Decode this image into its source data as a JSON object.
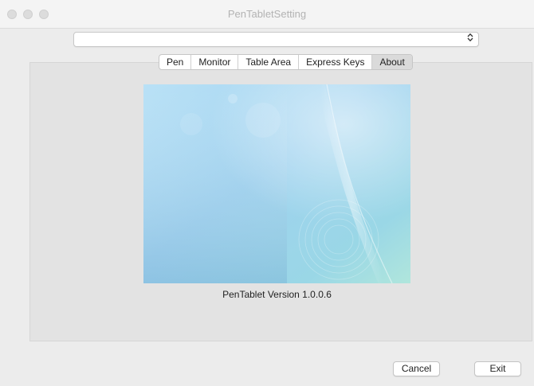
{
  "window": {
    "title": "PenTabletSetting"
  },
  "device_select": {
    "selected": "",
    "icon": "up-down-chevron-icon"
  },
  "tabs": [
    {
      "label": "Pen",
      "active": false
    },
    {
      "label": "Monitor",
      "active": false
    },
    {
      "label": "Table Area",
      "active": false
    },
    {
      "label": "Express Keys",
      "active": false
    },
    {
      "label": "About",
      "active": true
    }
  ],
  "about": {
    "version_text": "PenTablet Version  1.0.0.6"
  },
  "footer": {
    "cancel_label": "Cancel",
    "exit_label": "Exit"
  },
  "colors": {
    "window_bg": "#ececec",
    "panel_bg": "#e3e3e3",
    "image_blue": "#9fd3f0",
    "image_teal": "#a6e0de"
  }
}
